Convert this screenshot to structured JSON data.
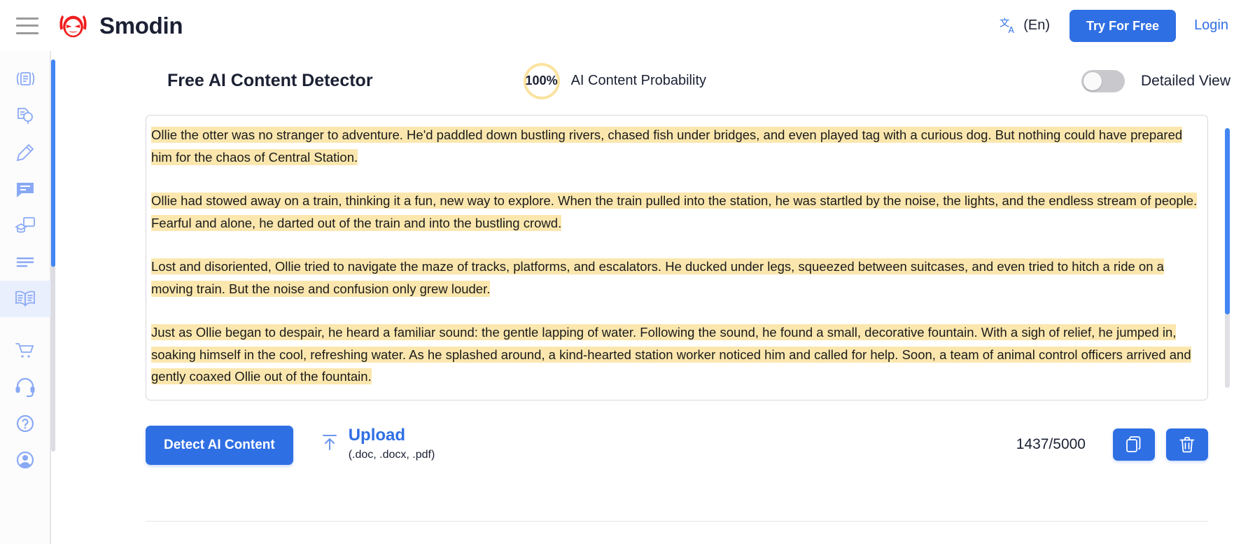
{
  "header": {
    "menu_icon": "hamburger-icon",
    "brand_logo_icon": "smodin-mask-logo",
    "brand_name": "Smodin",
    "language_icon": "translate-icon",
    "language_label": "(En)",
    "try_button": "Try For Free",
    "login_link": "Login",
    "accent_blue": "#2f6fe4"
  },
  "sidebar": {
    "items": [
      {
        "icon": "rewriter-document-icon",
        "active": false
      },
      {
        "icon": "plagiarism-search-icon",
        "active": false
      },
      {
        "icon": "pencil-writer-icon",
        "active": false
      },
      {
        "icon": "chat-bubble-icon",
        "active": false
      },
      {
        "icon": "homework-graduation-icon",
        "active": false
      },
      {
        "icon": "summarizer-lines-icon",
        "active": false
      },
      {
        "icon": "open-book-icon",
        "active": true
      },
      {
        "icon": "shopping-cart-icon",
        "active": false
      },
      {
        "icon": "headset-support-icon",
        "active": false
      },
      {
        "icon": "question-mark-icon",
        "active": false
      },
      {
        "icon": "account-avatar-icon",
        "active": false
      }
    ],
    "icon_color": "#8aa9f5",
    "active_bg": "#e9effd"
  },
  "panel": {
    "title": "Free AI Content Detector",
    "probability_value": "100%",
    "probability_label": "AI Content Probability",
    "probability_ring_color": "#fbe3a0",
    "detailed_view_label": "Detailed View",
    "detailed_view_on": false
  },
  "editor": {
    "highlight_color": "#fbe7ae",
    "paragraphs": [
      "Ollie the otter was no stranger to adventure. He'd paddled down bustling rivers, chased fish under bridges, and even played tag with a curious dog. But nothing could have prepared him for the chaos of Central Station.",
      "Ollie had stowed away on a train, thinking it a fun, new way to explore. When the train pulled into the station, he was startled by the noise, the lights, and the endless stream of people. Fearful and alone, he darted out of the train and into the bustling crowd.",
      "Lost and disoriented, Ollie tried to navigate the maze of tracks, platforms, and escalators. He ducked under legs, squeezed between suitcases, and even tried to hitch a ride on a moving train. But the noise and confusion only grew louder.",
      "Just as Ollie began to despair, he heard a familiar sound: the gentle lapping of water. Following the sound, he found a small, decorative fountain. With a sigh of relief, he jumped in, soaking himself in the cool, refreshing water. As he splashed around, a kind-hearted station worker noticed him and called for help. Soon, a team of animal control officers arrived and gently coaxed Ollie out of the fountain."
    ]
  },
  "actions": {
    "detect_button": "Detect AI Content",
    "upload_icon": "upload-arrow-icon",
    "upload_title": "Upload",
    "upload_formats": "(.doc, .docx, .pdf)",
    "character_counter": "1437/5000",
    "copy_icon": "copy-icon",
    "delete_icon": "trash-icon"
  }
}
